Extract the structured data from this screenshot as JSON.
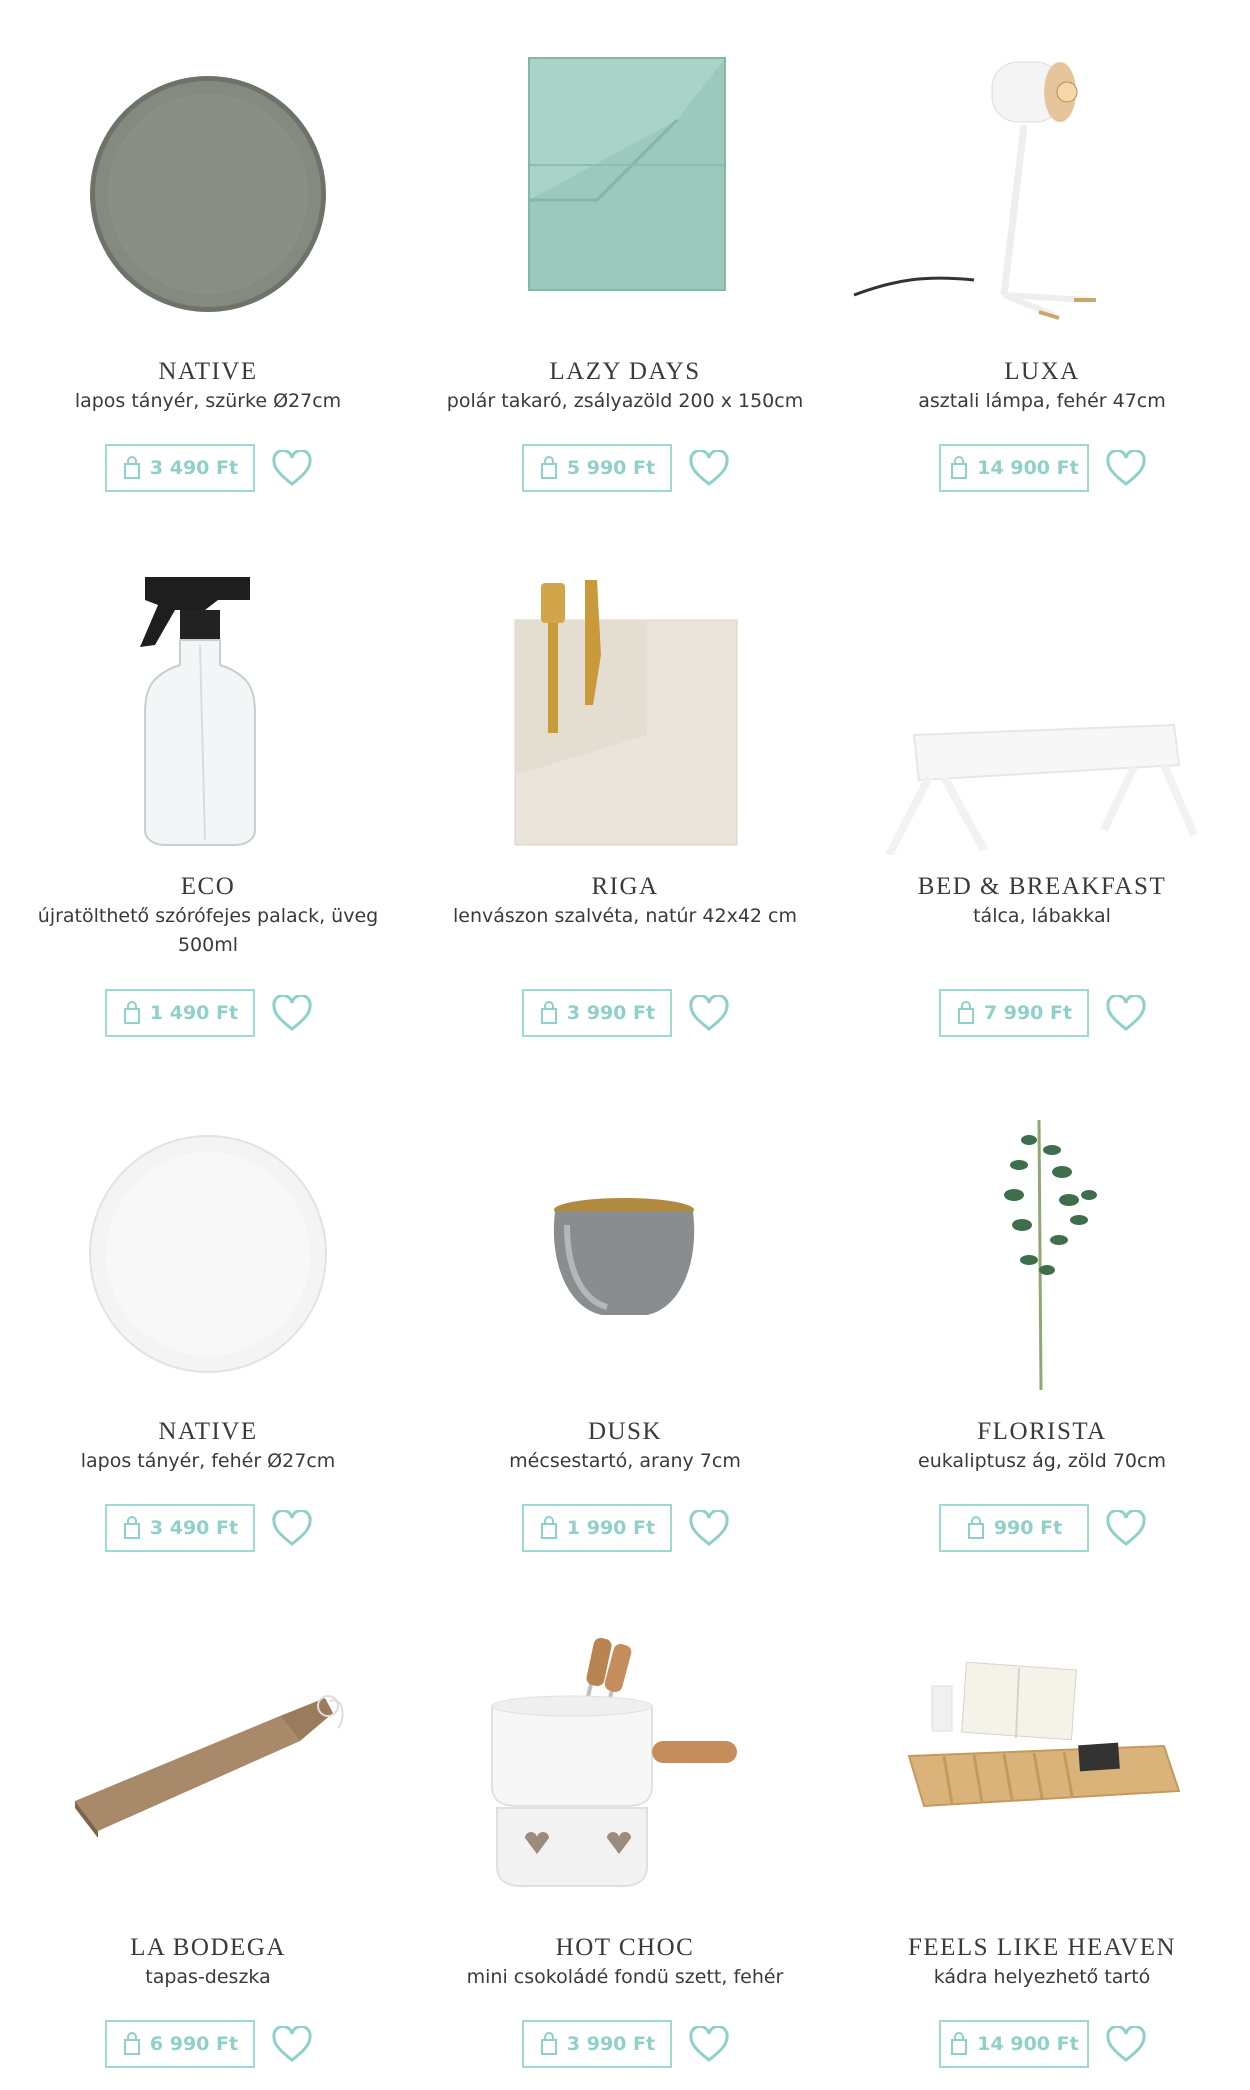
{
  "accent_color": "#8fd0c9",
  "products": [
    {
      "title": "NATIVE",
      "desc": "lapos tányér, szürke Ø27cm",
      "price": "3 490 Ft",
      "icon": "grey-plate"
    },
    {
      "title": "LAZY DAYS",
      "desc": "polár takaró, zsályazöld 200 x 150cm",
      "price": "5 990 Ft",
      "icon": "blanket"
    },
    {
      "title": "LUXA",
      "desc": "asztali lámpa, fehér 47cm",
      "price": "14 900 Ft",
      "icon": "lamp"
    },
    {
      "title": "ECO",
      "desc": "újratölthető szórófejes palack, üveg 500ml",
      "price": "1 490 Ft",
      "icon": "spray-bottle"
    },
    {
      "title": "RIGA",
      "desc": "lenvászon szalvéta, natúr 42x42 cm",
      "price": "3 990 Ft",
      "icon": "napkin"
    },
    {
      "title": "BED & BREAKFAST",
      "desc": "tálca, lábakkal",
      "price": "7 990 Ft",
      "icon": "tray"
    },
    {
      "title": "NATIVE",
      "desc": "lapos tányér, fehér Ø27cm",
      "price": "3 490 Ft",
      "icon": "white-plate"
    },
    {
      "title": "DUSK",
      "desc": "mécsestartó, arany 7cm",
      "price": "1 990 Ft",
      "icon": "candle-holder"
    },
    {
      "title": "FLORISTA",
      "desc": "eukaliptusz ág, zöld 70cm",
      "price": "990 Ft",
      "icon": "eucalyptus"
    },
    {
      "title": "LA BODEGA",
      "desc": "tapas-deszka",
      "price": "6 990 Ft",
      "icon": "cutting-board"
    },
    {
      "title": "HOT CHOC",
      "desc": "mini csokoládé fondü szett, fehér",
      "price": "3 990 Ft",
      "icon": "fondue-set"
    },
    {
      "title": "FEELS LIKE HEAVEN",
      "desc": "kádra helyezhető tartó",
      "price": "14 900 Ft",
      "icon": "bath-caddy"
    }
  ]
}
